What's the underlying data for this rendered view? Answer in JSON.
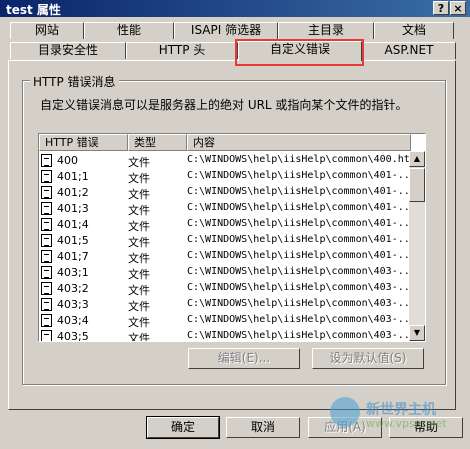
{
  "window": {
    "title": "test 属性",
    "help_button": "?",
    "close_button": "×"
  },
  "tabs_row1": [
    {
      "label": "网站"
    },
    {
      "label": "性能"
    },
    {
      "label": "ISAPI 筛选器"
    },
    {
      "label": "主目录"
    },
    {
      "label": "文档"
    }
  ],
  "tabs_row2": [
    {
      "label": "目录安全性"
    },
    {
      "label": "HTTP 头"
    },
    {
      "label": "自定义错误",
      "active": true
    },
    {
      "label": "ASP.NET"
    }
  ],
  "group": {
    "title": "HTTP 错误消息",
    "description": "自定义错误消息可以是服务器上的绝对 URL 或指向某个文件的指针。"
  },
  "table": {
    "columns": [
      "HTTP 错误",
      "类型",
      "内容"
    ],
    "rows": [
      {
        "code": "400",
        "type": "文件",
        "content": "C:\\WINDOWS\\help\\iisHelp\\common\\400.ht"
      },
      {
        "code": "401;1",
        "type": "文件",
        "content": "C:\\WINDOWS\\help\\iisHelp\\common\\401-..."
      },
      {
        "code": "401;2",
        "type": "文件",
        "content": "C:\\WINDOWS\\help\\iisHelp\\common\\401-..."
      },
      {
        "code": "401;3",
        "type": "文件",
        "content": "C:\\WINDOWS\\help\\iisHelp\\common\\401-..."
      },
      {
        "code": "401;4",
        "type": "文件",
        "content": "C:\\WINDOWS\\help\\iisHelp\\common\\401-..."
      },
      {
        "code": "401;5",
        "type": "文件",
        "content": "C:\\WINDOWS\\help\\iisHelp\\common\\401-..."
      },
      {
        "code": "401;7",
        "type": "文件",
        "content": "C:\\WINDOWS\\help\\iisHelp\\common\\401-..."
      },
      {
        "code": "403;1",
        "type": "文件",
        "content": "C:\\WINDOWS\\help\\iisHelp\\common\\403-..."
      },
      {
        "code": "403;2",
        "type": "文件",
        "content": "C:\\WINDOWS\\help\\iisHelp\\common\\403-..."
      },
      {
        "code": "403;3",
        "type": "文件",
        "content": "C:\\WINDOWS\\help\\iisHelp\\common\\403-..."
      },
      {
        "code": "403;4",
        "type": "文件",
        "content": "C:\\WINDOWS\\help\\iisHelp\\common\\403-..."
      },
      {
        "code": "403;5",
        "type": "文件",
        "content": "C:\\WINDOWS\\help\\iisHelp\\common\\403-..."
      }
    ]
  },
  "actions": {
    "edit": "编辑(E)...",
    "set_default": "设为默认值(S)"
  },
  "footer": {
    "ok": "确定",
    "cancel": "取消",
    "apply": "应用(A)",
    "help": "帮助"
  },
  "watermark": {
    "name": "新世界主机",
    "url": "www.vpser.net"
  },
  "colors": {
    "titlebar_start": "#0a246a",
    "titlebar_end": "#3a6ea5",
    "highlight": "#e53a3a",
    "face": "#d4d0c8"
  }
}
